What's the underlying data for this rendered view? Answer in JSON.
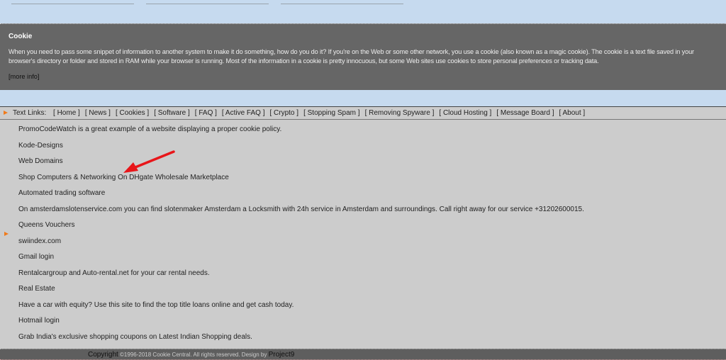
{
  "cookie": {
    "title": "Cookie",
    "text": "When you need to pass some snippet of information to another system to make it do something, how do you do it? If you're on the Web or some other network, you use a cookie (also known as a magic cookie). The cookie is a text file saved in your browser's directory or folder and stored in RAM while your browser is running. Most of the information in a cookie is pretty innocuous, but some Web sites use cookies to store personal preferences or tracking data.",
    "more_info": "[more info]"
  },
  "nav": {
    "label": "Text Links:",
    "links": [
      "[ Home ]",
      "[ News ]",
      "[ Cookies ]",
      "[ Software ]",
      "[ FAQ ]",
      "[ Active FAQ ]",
      "[ Crypto ]",
      "[ Stopping Spam ]",
      "[ Removing Spyware ]",
      "[ Cloud Hosting ]",
      "[ Message Board ]",
      "[ About ]"
    ]
  },
  "links": [
    "PromoCodeWatch is a great example of a website displaying a proper cookie policy.",
    "Kode-Designs",
    "Web Domains",
    "Shop Computers & Networking On DHgate Wholesale Marketplace",
    "Automated trading software",
    "On amsterdamslotenservice.com you can find slotenmaker Amsterdam a Locksmith with 24h service in Amsterdam and surroundings. Call right away for our service +31202600015.",
    "Queens Vouchers",
    "swiindex.com",
    "Gmail login",
    "Rentalcargroup and Auto-rental.net for your car rental needs.",
    "Real Estate",
    "Have a car with equity? Use this site to find the top title loans online and get cash today.",
    "Hotmail login",
    "Grab India's exclusive shopping coupons on Latest Indian Shopping deals."
  ],
  "footer": {
    "copyright": "Copyright",
    "text": " ©1996-2018 Cookie Central. All rights reserved. Design by ",
    "designer": "Project9"
  },
  "colors": {
    "accent_arrow": "#e8161a",
    "bullet": "#f07a1a"
  }
}
